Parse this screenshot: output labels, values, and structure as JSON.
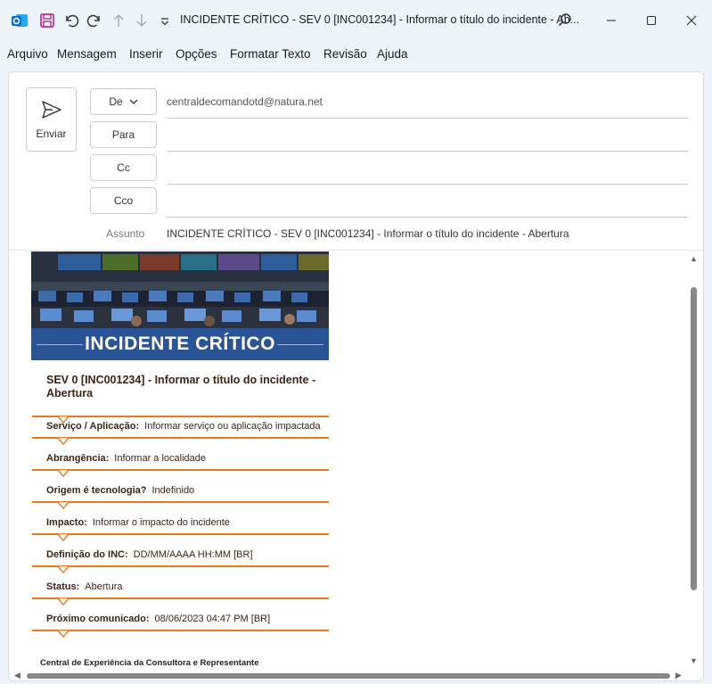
{
  "window": {
    "title": "INCIDENTE CRÍTICO - SEV 0 [INC001234] - Informar o título do incidente - Ab..."
  },
  "menu": [
    "Arquivo",
    "Mensagem",
    "Inserir",
    "Opções",
    "Formatar Texto",
    "Revisão",
    "Ajuda"
  ],
  "compose": {
    "send_label": "Enviar",
    "from_label": "De",
    "from_value": "centraldecomandotd@natura.net",
    "to_label": "Para",
    "cc_label": "Cc",
    "bcc_label": "Cco",
    "subject_label": "Assunto",
    "subject_value": "INCIDENTE CRÍTICO - SEV 0 [INC001234] - Informar o título do incidente - Abertura"
  },
  "email": {
    "banner_title": "INCIDENTE CRÍTICO",
    "incident_title": "SEV 0 [INC001234] - Informar o título do incidente - Abertura",
    "fields": [
      {
        "label": "Serviço / Aplicação:",
        "value": "Informar serviço ou aplicação impactada"
      },
      {
        "label": "Abrangência:",
        "value": "Informar a localidade"
      },
      {
        "label": "Origem é tecnologia?",
        "value": "Indefinido"
      },
      {
        "label": "Impacto:",
        "value": "Informar o impacto do incidente"
      },
      {
        "label": "Definição do INC:",
        "value": "DD/MM/AAAA HH:MM [BR]"
      },
      {
        "label": "Status:",
        "value": "Abertura"
      },
      {
        "label": "Próximo comunicado:",
        "value": "08/06/2023 04:47 PM [BR]"
      }
    ],
    "footer": "Central de Experiência da Consultora e Representante"
  },
  "colors": {
    "accent_orange": "#e87722",
    "banner_blue": "#2b5496",
    "outlook_blue": "#0f6cbd",
    "save_purple": "#b4268c"
  }
}
